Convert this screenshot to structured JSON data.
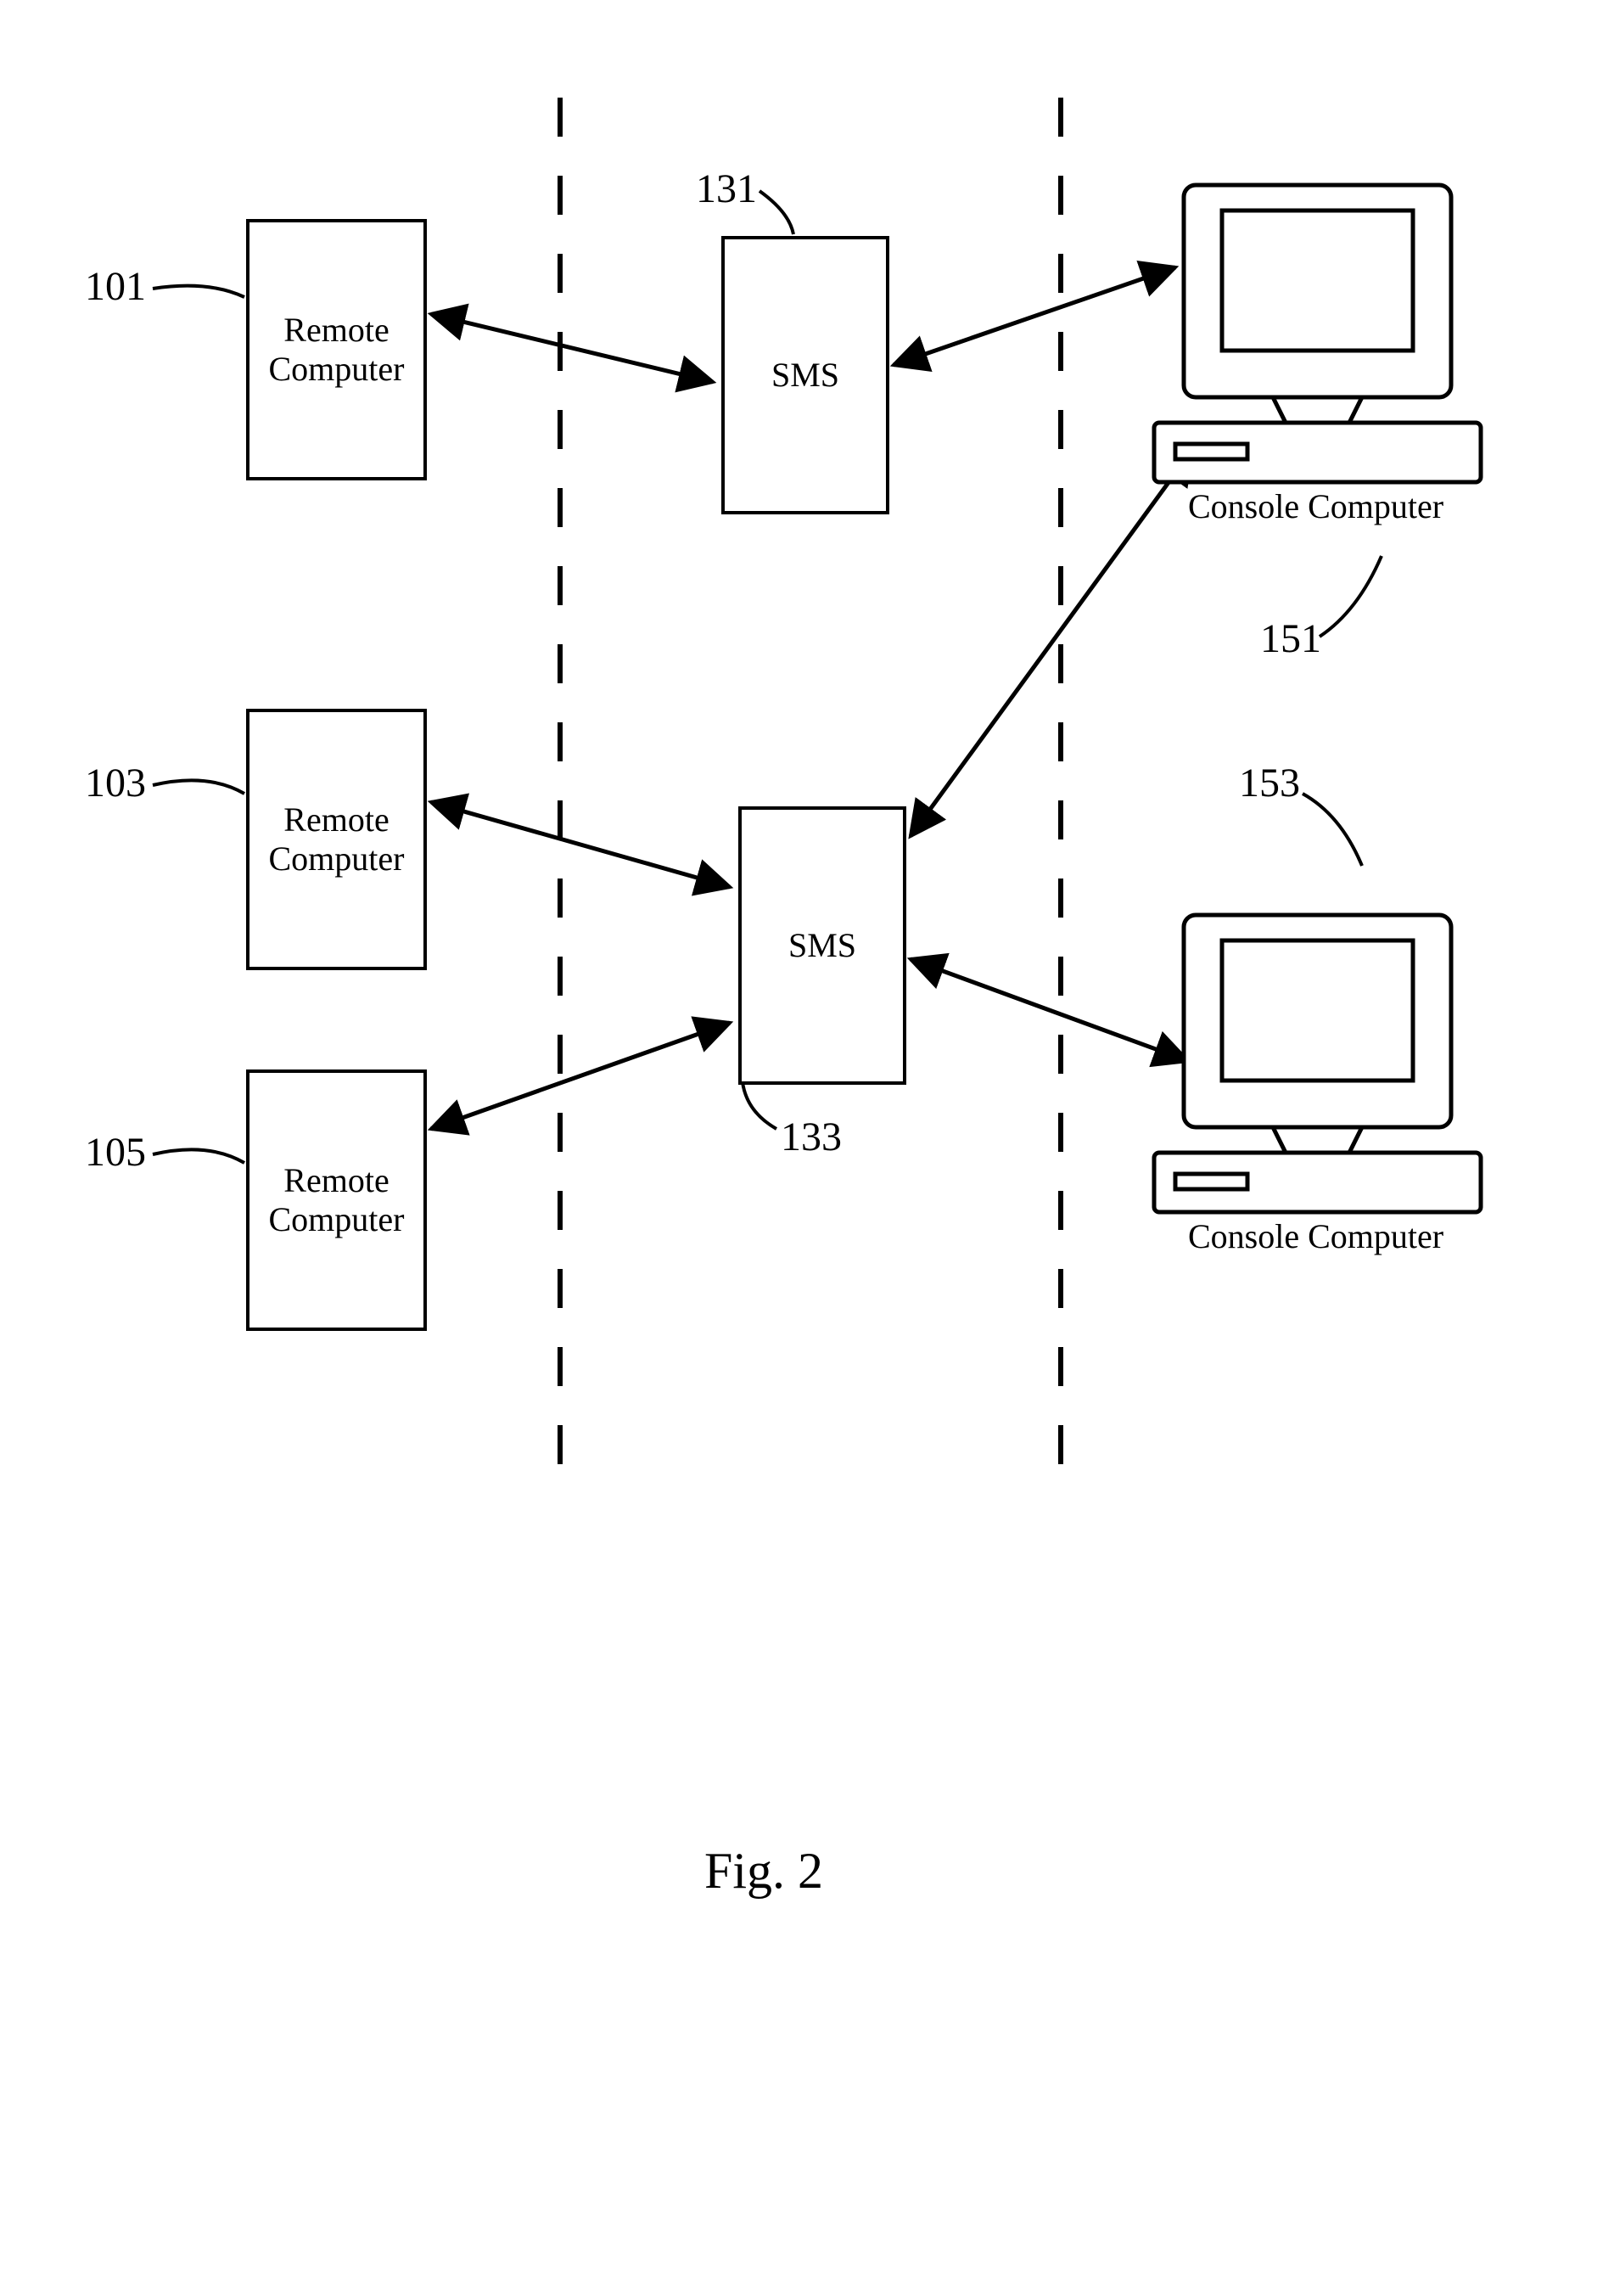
{
  "nodes": {
    "remote1": {
      "ref": "101",
      "label": "Remote\nComputer"
    },
    "remote2": {
      "ref": "103",
      "label": "Remote\nComputer"
    },
    "remote3": {
      "ref": "105",
      "label": "Remote\nComputer"
    },
    "sms1": {
      "ref": "131",
      "label": "SMS"
    },
    "sms2": {
      "ref": "133",
      "label": "SMS"
    },
    "console1": {
      "ref": "151",
      "label": "Console Computer"
    },
    "console2": {
      "ref": "153",
      "label": "Console Computer"
    }
  },
  "figure_caption": "Fig. 2",
  "connections": [
    {
      "from": "remote1",
      "to": "sms1",
      "bidirectional": true
    },
    {
      "from": "sms1",
      "to": "console1",
      "bidirectional": true
    },
    {
      "from": "remote2",
      "to": "sms2",
      "bidirectional": true
    },
    {
      "from": "remote3",
      "to": "sms2",
      "bidirectional": true
    },
    {
      "from": "sms2",
      "to": "console1",
      "bidirectional": true
    },
    {
      "from": "sms2",
      "to": "console2",
      "bidirectional": true
    }
  ]
}
